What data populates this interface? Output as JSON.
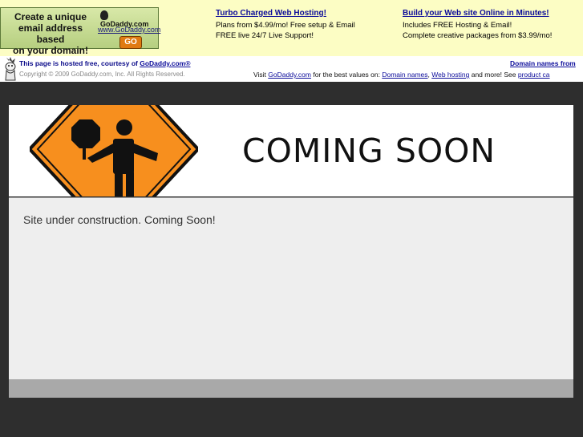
{
  "ad": {
    "box_text": "Create a unique\nemail address based\non your domain!",
    "logo_text": "GoDaddy",
    "logo_suffix": ".com",
    "url": "www.GoDaddy.com",
    "go_label": "GO"
  },
  "promos": [
    {
      "title": "Turbo Charged Web Hosting!",
      "lines": [
        "Plans from $4.99/mo! Free setup & Email",
        "FREE live 24/7 Live Support!"
      ]
    },
    {
      "title": "Build your Web site Online in Minutes!",
      "lines": [
        "Includes FREE Hosting & Email!",
        "Complete creative packages from $3.99/mo!"
      ]
    }
  ],
  "hosted": {
    "prefix": "This page is hosted free, courtesy of ",
    "link": "GoDaddy.com®",
    "copyright": "Copyright © 2009 GoDaddy.com, Inc. All Rights Reserved.",
    "domain_names_link": "Domain names from",
    "visit_prefix": "Visit ",
    "visit_link": "GoDaddy.com",
    "visit_mid": " for the best values on: ",
    "domain_names": "Domain names",
    "comma": ", ",
    "web_hosting": "Web hosting",
    "visit_suffix": " and more! See ",
    "product_link": "product ca"
  },
  "page": {
    "title": "COMING SOON",
    "message": "Site under construction. Coming Soon!"
  },
  "colors": {
    "sign_orange": "#f78f1e",
    "background": "#2e2e2e",
    "ad_background": "#fcfdc4",
    "link_blue": "#0b0b9a"
  }
}
